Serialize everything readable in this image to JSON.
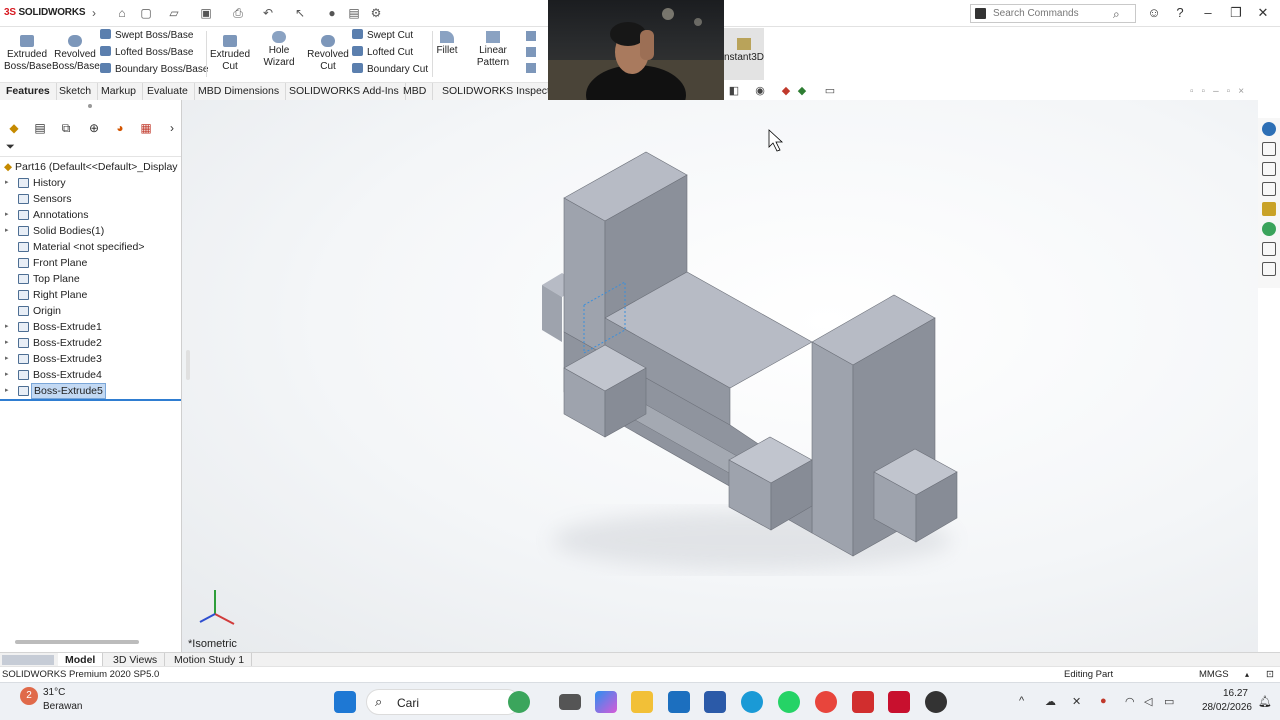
{
  "app": {
    "logo_text": "SOLIDWORKS",
    "logo_prefix": "3S"
  },
  "search": {
    "placeholder": "Search Commands"
  },
  "ribbon": {
    "extruded_boss": "Extruded\nBoss/Base",
    "revolved_boss": "Revolved\nBoss/Base",
    "swept_boss": "Swept Boss/Base",
    "lofted_boss": "Lofted Boss/Base",
    "boundary_boss": "Boundary Boss/Base",
    "extruded_cut": "Extruded\nCut",
    "hole_wizard": "Hole Wizard",
    "revolved_cut": "Revolved\nCut",
    "swept_cut": "Swept Cut",
    "lofted_cut": "Lofted Cut",
    "boundary_cut": "Boundary Cut",
    "fillet": "Fillet",
    "linear_pattern": "Linear Pattern",
    "instant3d": "nstant3D"
  },
  "tabs": [
    "Features",
    "Sketch",
    "Markup",
    "Evaluate",
    "MBD Dimensions",
    "SOLIDWORKS Add-Ins",
    "MBD",
    "SOLIDWORKS Inspectio"
  ],
  "tree": {
    "part": "Part16  (Default<<Default>_Display",
    "items": [
      {
        "label": "History",
        "arrow": true
      },
      {
        "label": "Sensors",
        "arrow": false
      },
      {
        "label": "Annotations",
        "arrow": true
      },
      {
        "label": "Solid Bodies(1)",
        "arrow": true
      },
      {
        "label": "Material <not specified>",
        "arrow": false
      },
      {
        "label": "Front Plane",
        "arrow": false
      },
      {
        "label": "Top Plane",
        "arrow": false
      },
      {
        "label": "Right Plane",
        "arrow": false
      },
      {
        "label": "Origin",
        "arrow": false
      },
      {
        "label": "Boss-Extrude1",
        "arrow": true
      },
      {
        "label": "Boss-Extrude2",
        "arrow": true
      },
      {
        "label": "Boss-Extrude3",
        "arrow": true
      },
      {
        "label": "Boss-Extrude4",
        "arrow": true
      },
      {
        "label": "Boss-Extrude5",
        "arrow": true,
        "selected": true
      }
    ]
  },
  "viewport": {
    "view_label": "*Isometric"
  },
  "bottom_tabs": [
    "Model",
    "3D Views",
    "Motion Study 1"
  ],
  "status": {
    "product": "SOLIDWORKS Premium 2020 SP5.0",
    "mode": "Editing Part",
    "units": "MMGS"
  },
  "taskbar": {
    "search": "Cari",
    "weather_temp": "31°C",
    "weather_desc": "Berawan",
    "time": "16.27",
    "date": "28/02/2026",
    "notif": "2"
  },
  "colors": {
    "accent": "#d71920",
    "body_face_top": "#b6bac4",
    "body_face_side": "#8d929d",
    "selection": "#c3d9f3"
  }
}
